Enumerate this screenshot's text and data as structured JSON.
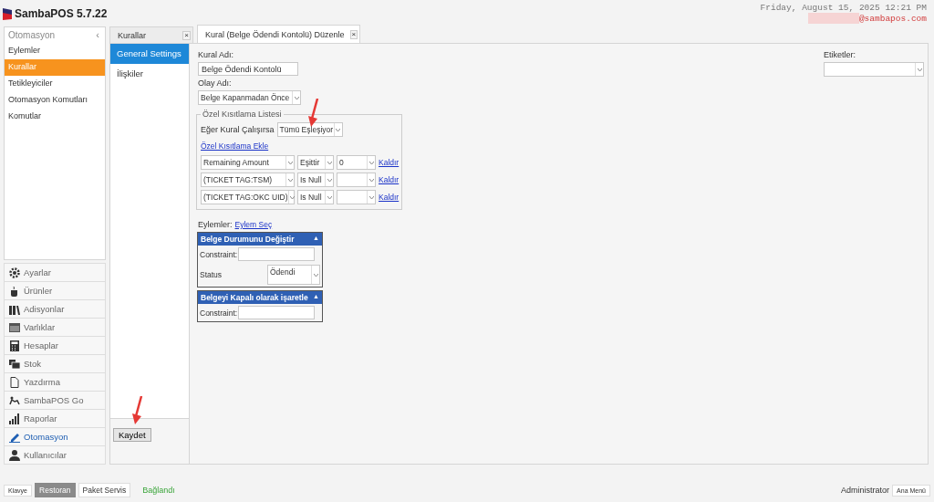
{
  "app": {
    "title": "SambaPOS 5.7.22",
    "datetime": "Friday, August 15, 2025 12:21 PM",
    "user_email": "@sambapos.com",
    "email_redacted": true
  },
  "sidebar": {
    "header": "Otomasyon",
    "collapse": "‹",
    "items": [
      {
        "label": "Eylemler",
        "selected": false
      },
      {
        "label": "Kurallar",
        "selected": true
      },
      {
        "label": "Tetikleyiciler",
        "selected": false
      },
      {
        "label": "Otomasyon Komutları",
        "selected": false
      },
      {
        "label": "Komutlar",
        "selected": false
      }
    ],
    "nav": [
      {
        "label": "Ayarlar",
        "selected": false
      },
      {
        "label": "Ürünler",
        "selected": false
      },
      {
        "label": "Adisyonlar",
        "selected": false
      },
      {
        "label": "Varlıklar",
        "selected": false
      },
      {
        "label": "Hesaplar",
        "selected": false
      },
      {
        "label": "Stok",
        "selected": false
      },
      {
        "label": "Yazdırma",
        "selected": false
      },
      {
        "label": "SambaPOS Go",
        "selected": false
      },
      {
        "label": "Raporlar",
        "selected": false
      },
      {
        "label": "Otomasyon",
        "selected": true
      },
      {
        "label": "Kullanıcılar",
        "selected": false
      }
    ]
  },
  "tabs": [
    {
      "label": "Kurallar",
      "close": "×",
      "selected": false
    },
    {
      "label": "Kural (Belge Ödendi Kontolü) Düzenle",
      "close": "×",
      "selected": true
    }
  ],
  "sections": [
    {
      "label": "General Settings",
      "selected": true
    },
    {
      "label": "İlişkiler",
      "selected": false
    }
  ],
  "form": {
    "rule_name_label": "Kural Adı:",
    "rule_name": "Belge Ödendi Kontolü",
    "event_label": "Olay Adı:",
    "event": "Belge Kapanmadan Önce",
    "tags_label": "Etiketler:",
    "constraints": {
      "legend": "Özel Kısıtlama Listesi",
      "match_label": "Eğer Kural Çalışırsa",
      "match": "Tümü Eşleşiyor",
      "add_link": "Özel Kısıtlama Ekle",
      "rows": [
        {
          "name": "Remaining Amount",
          "operation": "Eşittir",
          "value": "0",
          "remove": "Kaldır"
        },
        {
          "name": "(TICKET TAG:TSM)",
          "operation": "Is Null",
          "value": "",
          "remove": "Kaldır"
        },
        {
          "name": "(TICKET TAG:OKC UID)",
          "operation": "Is Null",
          "value": "",
          "remove": "Kaldır"
        }
      ]
    },
    "actions_label": "Eylemler:",
    "select_action_link": "Eylem Seç",
    "actions": [
      {
        "title": "Belge Durumunu Değiştir",
        "collapse": "▲",
        "fields": [
          {
            "kind": "text",
            "label": "Constraint:"
          },
          {
            "kind": "select",
            "label": "Status",
            "value": "Ödendi"
          }
        ]
      },
      {
        "title": "Belgeyi Kapalı olarak işaretle",
        "collapse": "▲",
        "fields": [
          {
            "kind": "text",
            "label": "Constraint:"
          }
        ]
      }
    ],
    "save": "Kaydet"
  },
  "status_bar": {
    "buttons": [
      {
        "label": "Klavye",
        "selected": false
      },
      {
        "label": "Restoran",
        "selected": true
      },
      {
        "label": "Paket Servis",
        "selected": false
      }
    ],
    "connection": "Bağlandı",
    "user": "Administrator",
    "menu": "Ana Menü"
  },
  "annotations": [
    {
      "kind": "arrow"
    },
    {
      "kind": "arrow"
    }
  ]
}
